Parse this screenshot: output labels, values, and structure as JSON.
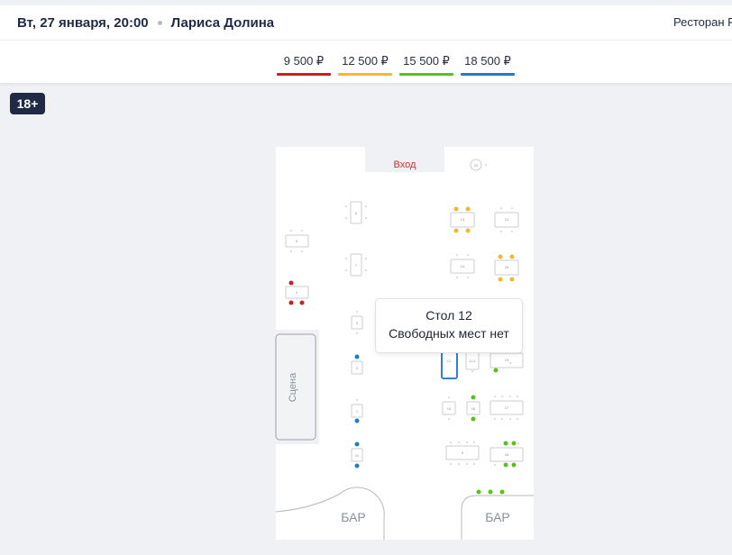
{
  "header": {
    "date": "Вт, 27 января, 20:00",
    "artist": "Лариса Долина",
    "venue": "Ресторан Р"
  },
  "prices": [
    {
      "label": "9 500 ₽",
      "color": "#cc1f1f"
    },
    {
      "label": "12 500 ₽",
      "color": "#f0b92e"
    },
    {
      "label": "15 500 ₽",
      "color": "#5cc01c"
    },
    {
      "label": "18 500 ₽",
      "color": "#1f7cc9"
    }
  ],
  "age_badge": "18+",
  "hall": {
    "entrance": "Вход",
    "stage": "Сцена",
    "bar_left": "БАР",
    "bar_right": "БАР"
  },
  "tables": [
    "8",
    "7",
    "3",
    "2",
    "1",
    "5",
    "4",
    "11",
    "9",
    "13",
    "14",
    "21",
    "20",
    "12",
    "12.1",
    "19",
    "15",
    "16",
    "17",
    "18",
    "22"
  ],
  "tooltip": {
    "title": "Стол 12",
    "subtitle": "Свободных мест нет"
  }
}
